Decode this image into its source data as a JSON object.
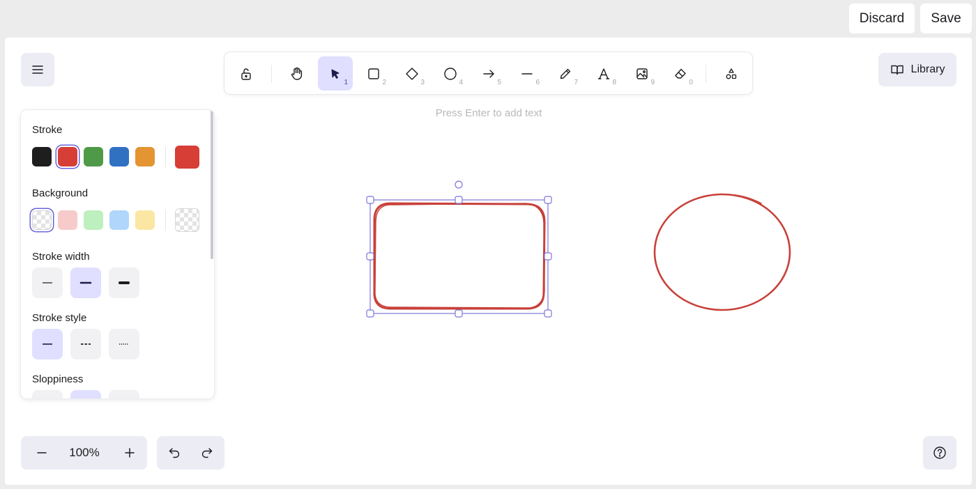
{
  "topbar": {
    "discard_label": "Discard",
    "save_label": "Save"
  },
  "menu": {
    "icon": "hamburger-menu-icon"
  },
  "toolbar": {
    "tools": [
      {
        "name": "lock",
        "icon": "lock-icon",
        "key": ""
      },
      {
        "name": "hand",
        "icon": "hand-icon",
        "key": ""
      },
      {
        "name": "selection",
        "icon": "cursor-icon",
        "key": "1",
        "active": true
      },
      {
        "name": "rectangle",
        "icon": "rectangle-icon",
        "key": "2"
      },
      {
        "name": "diamond",
        "icon": "diamond-icon",
        "key": "3"
      },
      {
        "name": "ellipse",
        "icon": "ellipse-icon",
        "key": "4"
      },
      {
        "name": "arrow",
        "icon": "arrow-icon",
        "key": "5"
      },
      {
        "name": "line",
        "icon": "line-icon",
        "key": "6"
      },
      {
        "name": "draw",
        "icon": "pencil-icon",
        "key": "7"
      },
      {
        "name": "text",
        "icon": "text-icon",
        "key": "8"
      },
      {
        "name": "image",
        "icon": "image-icon",
        "key": "9"
      },
      {
        "name": "eraser",
        "icon": "eraser-icon",
        "key": "0"
      },
      {
        "name": "more-shapes",
        "icon": "shapes-icon",
        "key": ""
      }
    ]
  },
  "library": {
    "label": "Library",
    "icon": "book-open-icon"
  },
  "canvas": {
    "hint": "Press Enter to add text"
  },
  "properties": {
    "stroke": {
      "title": "Stroke",
      "colors": [
        "#1e1e1e",
        "#d63e36",
        "#4f9a48",
        "#3071c2",
        "#e49432"
      ],
      "selected_index": 1,
      "current": "#d63e36"
    },
    "background": {
      "title": "Background",
      "colors": [
        "transparent",
        "#f6cbc9",
        "#bdefbf",
        "#b0d6fb",
        "#fbe7a3"
      ],
      "selected_index": 0,
      "current": "transparent"
    },
    "stroke_width": {
      "title": "Stroke width",
      "options": [
        "thin",
        "bold",
        "extra-bold"
      ],
      "selected_index": 1
    },
    "stroke_style": {
      "title": "Stroke style",
      "options": [
        "solid",
        "dashed",
        "dotted"
      ],
      "selected_index": 0
    },
    "sloppiness": {
      "title": "Sloppiness",
      "options": [
        "architect",
        "artist",
        "cartoonist"
      ],
      "selected_index": 1
    }
  },
  "footer": {
    "zoom": "100%",
    "zoom_out_icon": "minus-icon",
    "zoom_in_icon": "plus-icon",
    "undo_icon": "undo-icon",
    "redo_icon": "redo-icon",
    "help_icon": "help-circle-icon"
  },
  "colors": {
    "accent": "#6965db",
    "accent_light": "#e0dfff",
    "shape_stroke": "#c8413a",
    "island_bg": "#ececf4"
  }
}
